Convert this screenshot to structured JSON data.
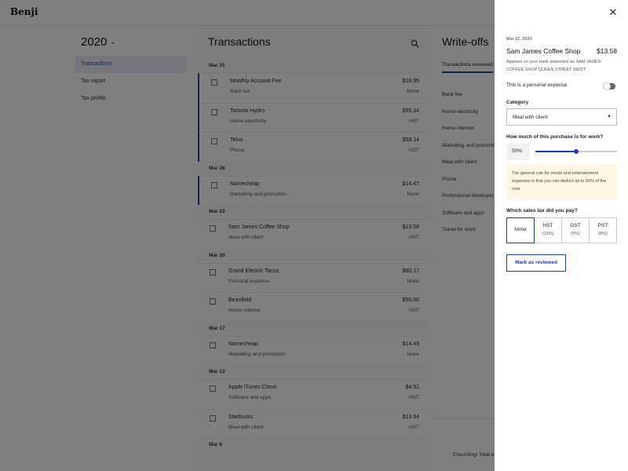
{
  "app": {
    "logo": "Benji"
  },
  "nav": {
    "year": "2020",
    "items": [
      {
        "label": "Transactions"
      },
      {
        "label": "Tax report"
      },
      {
        "label": "Tax profile"
      }
    ]
  },
  "transactions": {
    "title": "Transactions",
    "groups": [
      {
        "date": "Mar 31",
        "rows": [
          {
            "name": "Monthly Account Fee",
            "category": "Bank fee",
            "amount": "$10.95",
            "tax": "None"
          },
          {
            "name": "Toronto Hydro",
            "category": "Home electricity",
            "amount": "$55.34",
            "tax": "HST"
          },
          {
            "name": "Telus",
            "category": "Phone",
            "amount": "$59.14",
            "tax": "HST"
          }
        ]
      },
      {
        "date": "Mar 26",
        "rows": [
          {
            "name": "Namecheap",
            "category": "Marketing and promotion",
            "amount": "$14.47",
            "tax": "None"
          }
        ]
      },
      {
        "date": "Mar 22",
        "rows": [
          {
            "name": "Sam James Coffee Shop",
            "category": "Meal with client",
            "amount": "$13.58",
            "tax": "HST"
          }
        ]
      },
      {
        "date": "Mar 20",
        "rows": [
          {
            "name": "Grand Electric Tacos",
            "category": "Personal expense",
            "amount": "$60.17",
            "tax": "None"
          },
          {
            "name": "Beanfield",
            "category": "Home internet",
            "amount": "$56.50",
            "tax": "HST"
          }
        ]
      },
      {
        "date": "Mar 17",
        "rows": [
          {
            "name": "Namecheap",
            "category": "Marketing and promotion",
            "amount": "$14.49",
            "tax": "None"
          }
        ]
      },
      {
        "date": "Mar 12",
        "rows": [
          {
            "name": "Apple iTunes Cloud",
            "category": "Software and apps",
            "amount": "$4.51",
            "tax": "HST"
          },
          {
            "name": "Starbucks",
            "category": "Meal with client",
            "amount": "$13.94",
            "tax": "HST"
          }
        ]
      },
      {
        "date": "Mar 8",
        "rows": []
      }
    ]
  },
  "writeoffs": {
    "title": "Write-offs",
    "tab": "Transactions reviewed",
    "categories": [
      "Bank fee",
      "Home electricity",
      "Home internet",
      "Marketing and promotio",
      "Meal with client",
      "Phone",
      "Professional developm",
      "Software and apps",
      "Travel for work"
    ],
    "footer": "Cha-ching! Total e"
  },
  "drawer": {
    "date": "Mar 22, 2020",
    "merchant": "Sam James Coffee Shop",
    "amount": "$13.58",
    "note": "Appears on your bank statement as SAM JAMES COFFEE SHOP QUEEN STREET WEST",
    "personal_label": "This is a personal expense",
    "personal_on": false,
    "category_label": "Category",
    "category_value": "Meal with client",
    "work_label": "How much of this purchase is for work?",
    "work_pct_text": "50%",
    "work_pct": 0.5,
    "info": "The general rule for meals and entertainment expenses is that you can deduct up to 50% of the cost.",
    "tax_label": "Which sales tax did you pay?",
    "tax_options": [
      {
        "name": "None",
        "rate": "",
        "selected": true
      },
      {
        "name": "HST",
        "rate": "(13%)",
        "selected": false
      },
      {
        "name": "GST",
        "rate": "(5%)",
        "selected": false
      },
      {
        "name": "PST",
        "rate": "(8%)",
        "selected": false
      }
    ],
    "mark_button": "Mark as reviewed"
  },
  "colors": {
    "accent": "#1a3faa",
    "overlay": "rgba(0,0,0,0.5)",
    "info_bg": "#fdf6e3"
  },
  "icons": {
    "close": "close-icon",
    "search": "search-icon",
    "caret": "chevron-down-icon"
  }
}
